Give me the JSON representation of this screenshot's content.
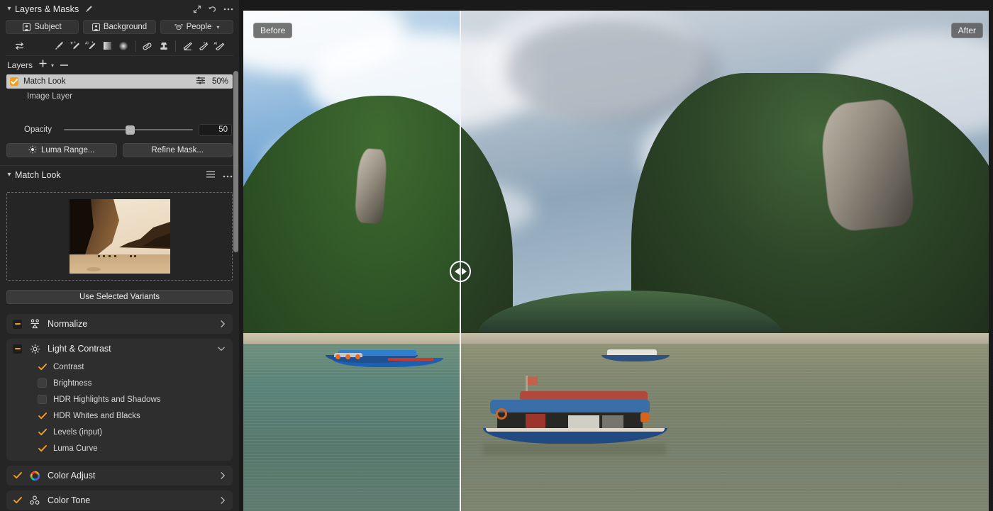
{
  "panel": {
    "title": "Layers & Masks",
    "collapse_icon": "chevron-down-icon",
    "title_icon": "brush-icon",
    "header_icons": [
      "expand-arrows-icon",
      "reset-arrow-icon",
      "more-options-icon"
    ],
    "segments": [
      {
        "label": "Subject",
        "icon": "person-icon"
      },
      {
        "label": "Background",
        "icon": "background-person-icon"
      },
      {
        "label": "People",
        "icon": "face-detect-icon",
        "has_chevron": true
      }
    ],
    "tools": [
      "cursor-arrows-icon",
      "brush-icon",
      "magic-brush-icon",
      "ai-brush-icon",
      "linear-gradient-icon",
      "radial-gradient-icon",
      "healing-icon",
      "clone-stamp-icon",
      "eraser-icon",
      "magic-eraser-icon",
      "ai-eraser-icon"
    ],
    "layers": {
      "label": "Layers",
      "add_icon": "plus-icon",
      "add_chevron_icon": "chevron-down-icon",
      "remove_icon": "minus-icon",
      "rows": [
        {
          "name": "Match Look",
          "checked": true,
          "selected": true,
          "opacity_text": "50%",
          "settings_icon": "sliders-icon"
        }
      ],
      "base_layer": "Image Layer"
    },
    "opacity": {
      "label": "Opacity",
      "value": "50",
      "knob_percent": 48
    },
    "mask_buttons": [
      {
        "label": "Luma Range...",
        "icon": "sun-icon"
      },
      {
        "label": "Refine Mask...",
        "icon": ""
      }
    ]
  },
  "match_look": {
    "title": "Match Look",
    "collapse_icon": "chevron-down-icon",
    "icons": [
      "list-icon",
      "more-options-icon"
    ],
    "drop_zone": {
      "thumbnail": "sepia-canyon-reference-photo"
    },
    "use_button": "Use Selected Variants"
  },
  "adjustments": [
    {
      "name": "Normalize",
      "icon": "normalize-icon",
      "state": "partial",
      "expanded": false,
      "arrow": "chevron-right-icon",
      "options": []
    },
    {
      "name": "Light & Contrast",
      "icon": "light-contrast-icon",
      "state": "partial",
      "expanded": true,
      "arrow": "chevron-down-icon",
      "options": [
        {
          "label": "Contrast",
          "checked": true
        },
        {
          "label": "Brightness",
          "checked": false
        },
        {
          "label": "HDR Highlights and Shadows",
          "checked": false
        },
        {
          "label": "HDR Whites and Blacks",
          "checked": true
        },
        {
          "label": "Levels (input)",
          "checked": true
        },
        {
          "label": "Luma Curve",
          "checked": true
        }
      ]
    },
    {
      "name": "Color Adjust",
      "icon": "color-wheel-icon",
      "state": "checked",
      "expanded": false,
      "arrow": "chevron-right-icon",
      "options": []
    },
    {
      "name": "Color Tone",
      "icon": "color-tone-icon",
      "state": "checked",
      "expanded": false,
      "arrow": "chevron-right-icon",
      "options": []
    }
  ],
  "viewer": {
    "before_label": "Before",
    "after_label": "After",
    "handle_icons": [
      "triangle-left-icon",
      "triangle-right-icon"
    ],
    "scene": "tropical bay with limestone karst cliffs, forested hills, and moored longtail boats"
  },
  "colors": {
    "accent": "#f0a020",
    "panel_bg": "#252525",
    "card_bg": "#2e2e2e",
    "selected_row": "#c9c9c9",
    "text": "#e8e8e8"
  }
}
